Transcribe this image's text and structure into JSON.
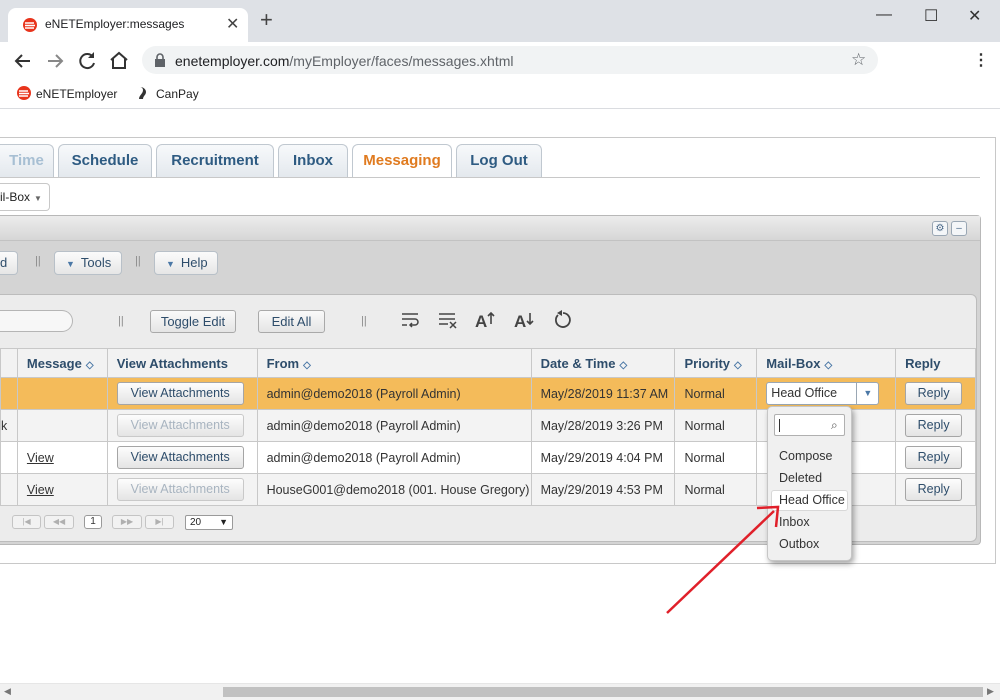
{
  "browser": {
    "tab_title": "eNETEmployer:messages",
    "url_domain": "enetemployer.com",
    "url_path": "/myEmployer/faces/messages.xhtml",
    "bookmarks": [
      {
        "label": "eNETEmployer",
        "icon": "enet-logo-icon"
      },
      {
        "label": "CanPay",
        "icon": "canpay-logo-icon"
      }
    ],
    "accent_color": "#e8341c"
  },
  "nav": {
    "tabs": [
      {
        "label": "Time"
      },
      {
        "label": "Schedule"
      },
      {
        "label": "Recruitment"
      },
      {
        "label": "Inbox"
      },
      {
        "label": "Messaging"
      },
      {
        "label": "Log Out"
      }
    ],
    "active_tab": "Messaging",
    "submenu_label": "il-Box"
  },
  "toolbar": {
    "partial_label": "d",
    "tools_label": "Tools",
    "help_label": "Help"
  },
  "grid": {
    "toggle_edit_label": "Toggle Edit",
    "edit_all_label": "Edit All",
    "columns": [
      {
        "label": "",
        "sortable": false
      },
      {
        "label": "Message",
        "sortable": true
      },
      {
        "label": "View Attachments",
        "sortable": false
      },
      {
        "label": "From",
        "sortable": true
      },
      {
        "label": "Date & Time",
        "sortable": true
      },
      {
        "label": "Priority",
        "sortable": true
      },
      {
        "label": "Mail-Box",
        "sortable": true
      },
      {
        "label": "Reply",
        "sortable": false
      }
    ],
    "rows": [
      {
        "lead": "",
        "message": "",
        "attach": "View Attachments",
        "attach_enabled": true,
        "from": "admin@demo2018 (Payroll Admin)",
        "datetime": "May/28/2019 11:37 AM",
        "priority": "Normal",
        "mailbox": "Head Office",
        "reply": "Reply"
      },
      {
        "lead": "k",
        "message": "",
        "attach": "View Attachments",
        "attach_enabled": false,
        "from": "admin@demo2018 (Payroll Admin)",
        "datetime": "May/28/2019 3:26 PM",
        "priority": "Normal",
        "mailbox": "",
        "reply": "Reply"
      },
      {
        "lead": "",
        "message": "View",
        "attach": "View Attachments",
        "attach_enabled": true,
        "from": "admin@demo2018 (Payroll Admin)",
        "datetime": "May/29/2019 4:04 PM",
        "priority": "Normal",
        "mailbox": "",
        "reply": "Reply"
      },
      {
        "lead": "",
        "message": "View",
        "attach": "View Attachments",
        "attach_enabled": false,
        "from": "HouseG001@demo2018 (001. House Gregory)",
        "datetime": "May/29/2019 4:53 PM",
        "priority": "Normal",
        "mailbox": "",
        "reply": "Reply"
      }
    ],
    "pager": {
      "current_page": "1",
      "page_size": "20"
    },
    "selected_row_color": "#f4bb5a"
  },
  "mailbox_dropdown": {
    "options": [
      "Compose",
      "Deleted",
      "Head Office",
      "Inbox",
      "Outbox"
    ],
    "highlighted": "Head Office"
  },
  "annotation": {
    "arrow_color": "#e0202a"
  }
}
